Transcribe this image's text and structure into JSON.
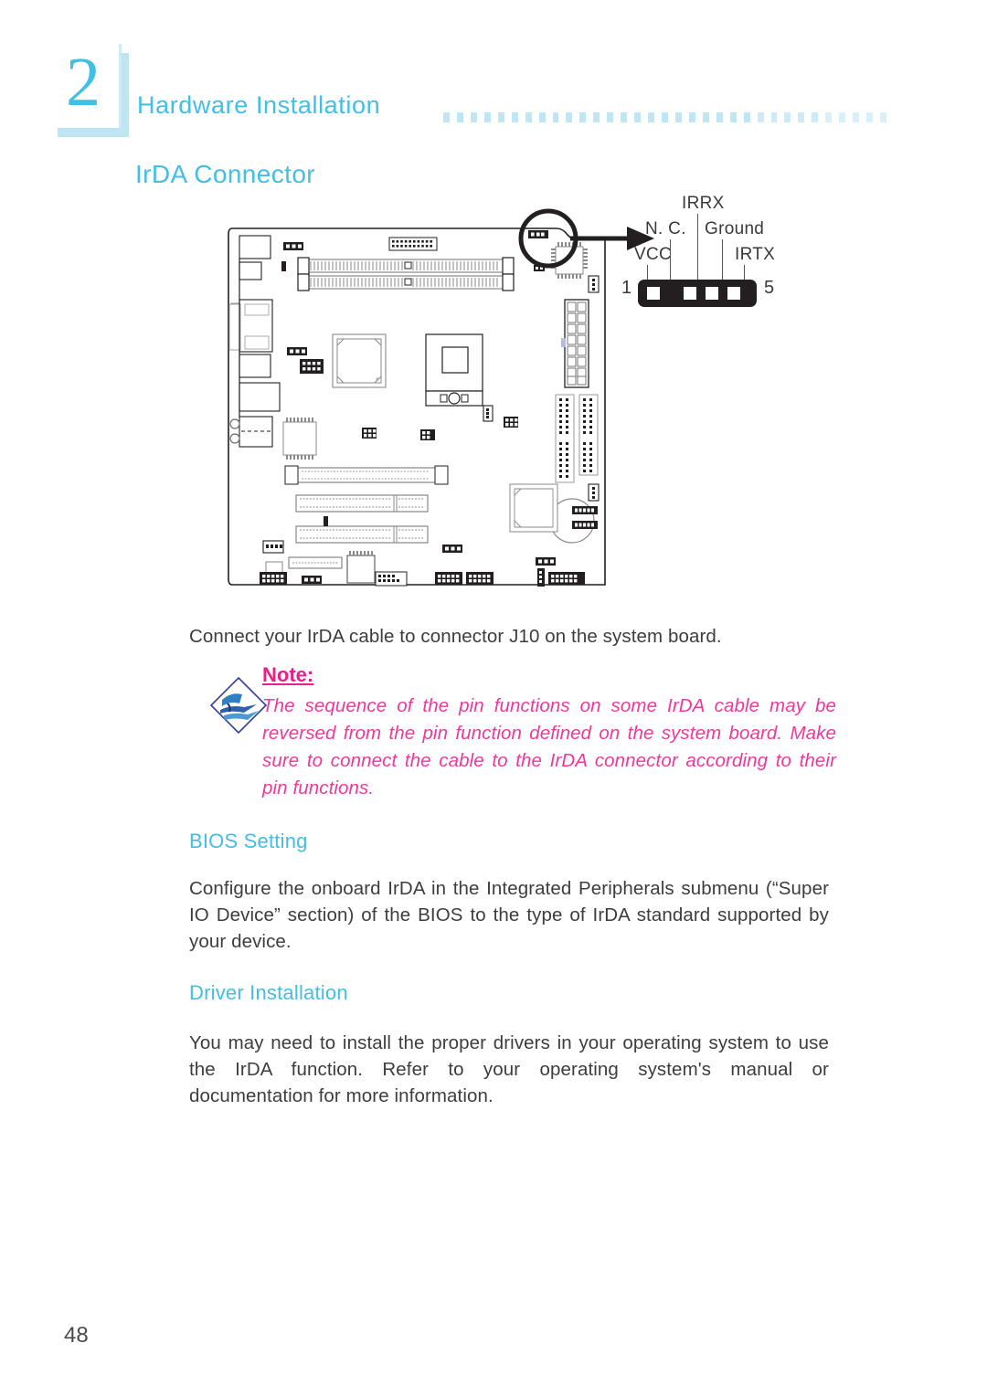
{
  "header": {
    "chapter_number": "2",
    "chapter_title": "Hardware Installation",
    "dot_count": 33,
    "accent_color": "#41bfe4"
  },
  "section": {
    "title": "IrDA Connector"
  },
  "figure": {
    "name": "system-board-diagram",
    "callout": {
      "magnifier": "magnifier-circle",
      "arrow": "arrow-right-icon"
    },
    "connector": {
      "name": "IrDA connector J10",
      "pin_first_label": "1",
      "pin_last_label": "5",
      "pin_count": 5,
      "pin_labels": [
        "VCC",
        "N. C.",
        "IRRX",
        "Ground",
        "IRTX"
      ],
      "labels": {
        "irrx": "IRRX",
        "nc": "N. C.",
        "ground": "Ground",
        "vcc": "VCC",
        "irtx": "IRTX"
      },
      "body_color": "#231f20"
    }
  },
  "content": {
    "intro": "Connect your IrDA cable to connector J10 on the system board.",
    "note": {
      "title": "Note:",
      "body": "The sequence of the pin functions on some IrDA cable may be reversed from the pin function defined on the system board. Make sure to connect the cable to the IrDA connector according to their pin functions.",
      "color": "#f0389b",
      "icon": "note-diamond-icon"
    },
    "bios": {
      "heading": "BIOS Setting",
      "body": "Configure the onboard IrDA in the Integrated Peripherals submenu (“Super IO Device” section) of the BIOS to the type of IrDA standard supported by your device."
    },
    "driver": {
      "heading": "Driver Installation",
      "body": "You may need to install the proper drivers in your operating system to use the IrDA function. Refer to your operating system's manual or documentation for more information."
    }
  },
  "footer": {
    "page_number": "48"
  }
}
